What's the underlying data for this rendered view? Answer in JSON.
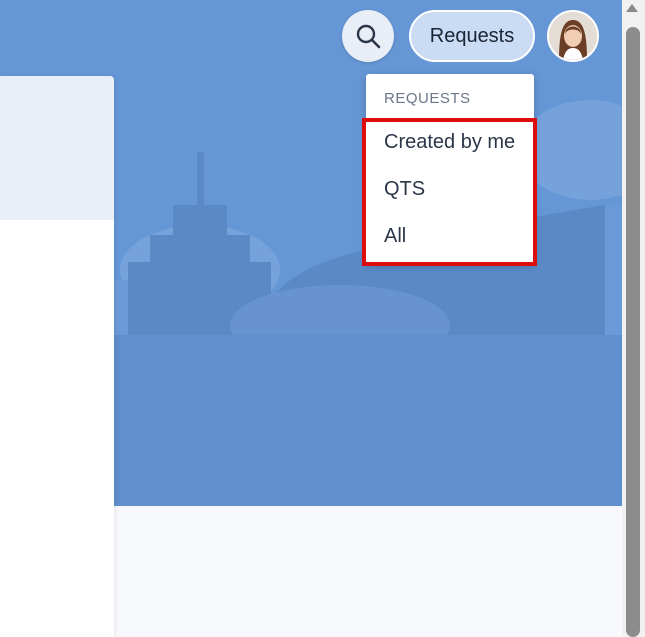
{
  "header": {
    "search_icon": "search-icon",
    "requests_label": "Requests",
    "avatar_icon": "user-avatar"
  },
  "dropdown": {
    "heading": "REQUESTS",
    "items": [
      {
        "label": "Created by me"
      },
      {
        "label": "QTS"
      },
      {
        "label": "All"
      }
    ]
  },
  "colors": {
    "hero_background": "#6596d6",
    "requests_button": "#c9dcf4",
    "highlight": "#dd0d0d"
  }
}
